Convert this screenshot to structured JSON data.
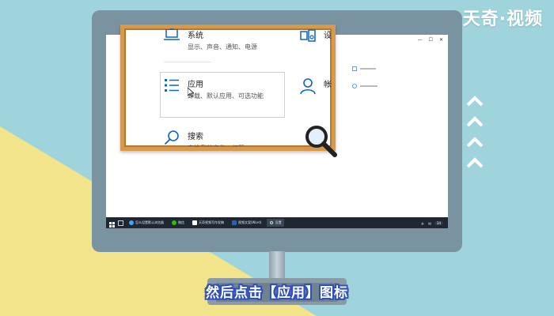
{
  "brand": "天奇·视频",
  "caption": "然后点击【应用】图标",
  "colors": {
    "background_blue": "#9fd4dc",
    "background_yellow": "#f2e48a",
    "monitor_frame": "#7a93a1",
    "frame_wood": "#d79a4c",
    "caption_outline": "#2f4fbf",
    "accent": "#0b63ce"
  },
  "settings": {
    "system": {
      "title": "系统",
      "desc": "显示、声音、通知、电源"
    },
    "apps": {
      "title": "应用",
      "desc": "卸载、默认应用、可选功能"
    },
    "search": {
      "title": "搜索",
      "desc": "查找我的文件、权限"
    },
    "devices": {
      "title": "设"
    },
    "accounts": {
      "title": "帐"
    }
  },
  "taskbar": {
    "items": [
      {
        "label": "怎么设置默认浏览器",
        "icon": "browser-icon"
      },
      {
        "label": "微信",
        "icon": "wechat-icon"
      },
      {
        "label": "天奇视频写作发稿",
        "icon": "document-icon"
      },
      {
        "label": "视频文案(Word)",
        "icon": "word-icon"
      },
      {
        "label": "设置",
        "icon": "gear-icon"
      }
    ],
    "tray_badge": "34"
  },
  "icons": [
    "laptop-icon",
    "apps-list-icon",
    "search-icon",
    "devices-icon",
    "person-icon",
    "magnifier-icon",
    "chevron-up-icon",
    "windows-start-icon"
  ]
}
